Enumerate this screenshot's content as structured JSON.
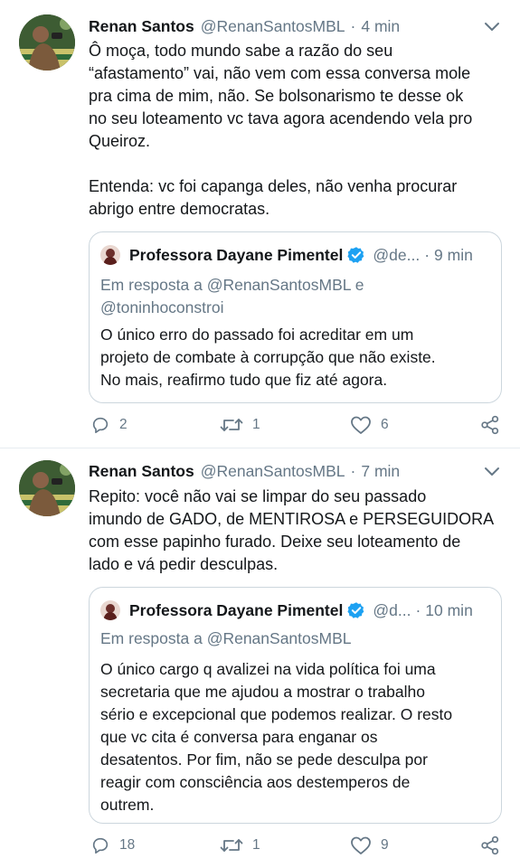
{
  "colors": {
    "text": "#14171a",
    "secondary": "#657786",
    "border": "#ccd6dd",
    "verified": "#1da1f2"
  },
  "tweets": [
    {
      "author": "Renan Santos",
      "handle": "@RenanSantosMBL",
      "separator": "·",
      "time": "4 min",
      "text": "Ô moça, todo mundo sabe a razão do seu\n“afastamento” vai, não vem com essa conversa mole\npra cima de mim, não. Se bolsonarismo te desse ok\nno seu loteamento vc tava agora acendendo vela pro\nQueiroz.\n\nEntenda: vc foi capanga deles, não venha procurar\nabrigo entre democratas.",
      "quote": {
        "author": "Professora Dayane Pimentel",
        "handle": "@de...",
        "separator": "·",
        "time": "9 min",
        "reply_to": "Em resposta a @RenanSantosMBL e\n@toninhoconstroi",
        "text": "O único erro do passado foi acreditar em um\nprojeto de combate à corrupção que não existe.\nNo mais, reafirmo tudo que fiz até agora."
      },
      "replies": "2",
      "retweets": "1",
      "likes": "6"
    },
    {
      "author": "Renan Santos",
      "handle": "@RenanSantosMBL",
      "separator": "·",
      "time": "7 min",
      "text": "Repito: você não vai se limpar do seu passado\nimundo de GADO, de MENTIROSA e PERSEGUIDORA\ncom esse papinho furado. Deixe seu loteamento de\nlado e vá pedir desculpas.",
      "quote": {
        "author": "Professora Dayane Pimentel",
        "handle": "@d...",
        "separator": "·",
        "time": "10 min",
        "reply_to": "Em resposta a @RenanSantosMBL",
        "text": "O único cargo q avalizei na vida política foi uma\nsecretaria que me ajudou a mostrar o trabalho\nsério e excepcional que podemos realizar. O resto\nque vc cita é conversa para enganar os\ndesatentos. Por fim, não se pede desculpa por\nreagir com consciência aos destemperos de\noutrem."
      },
      "replies": "18",
      "retweets": "1",
      "likes": "9"
    }
  ],
  "icons": {
    "reply": "reply-icon",
    "retweet": "retweet-icon",
    "like": "heart-icon",
    "share": "share-icon",
    "caret": "chevron-down-icon",
    "verified": "verified-badge-icon"
  }
}
